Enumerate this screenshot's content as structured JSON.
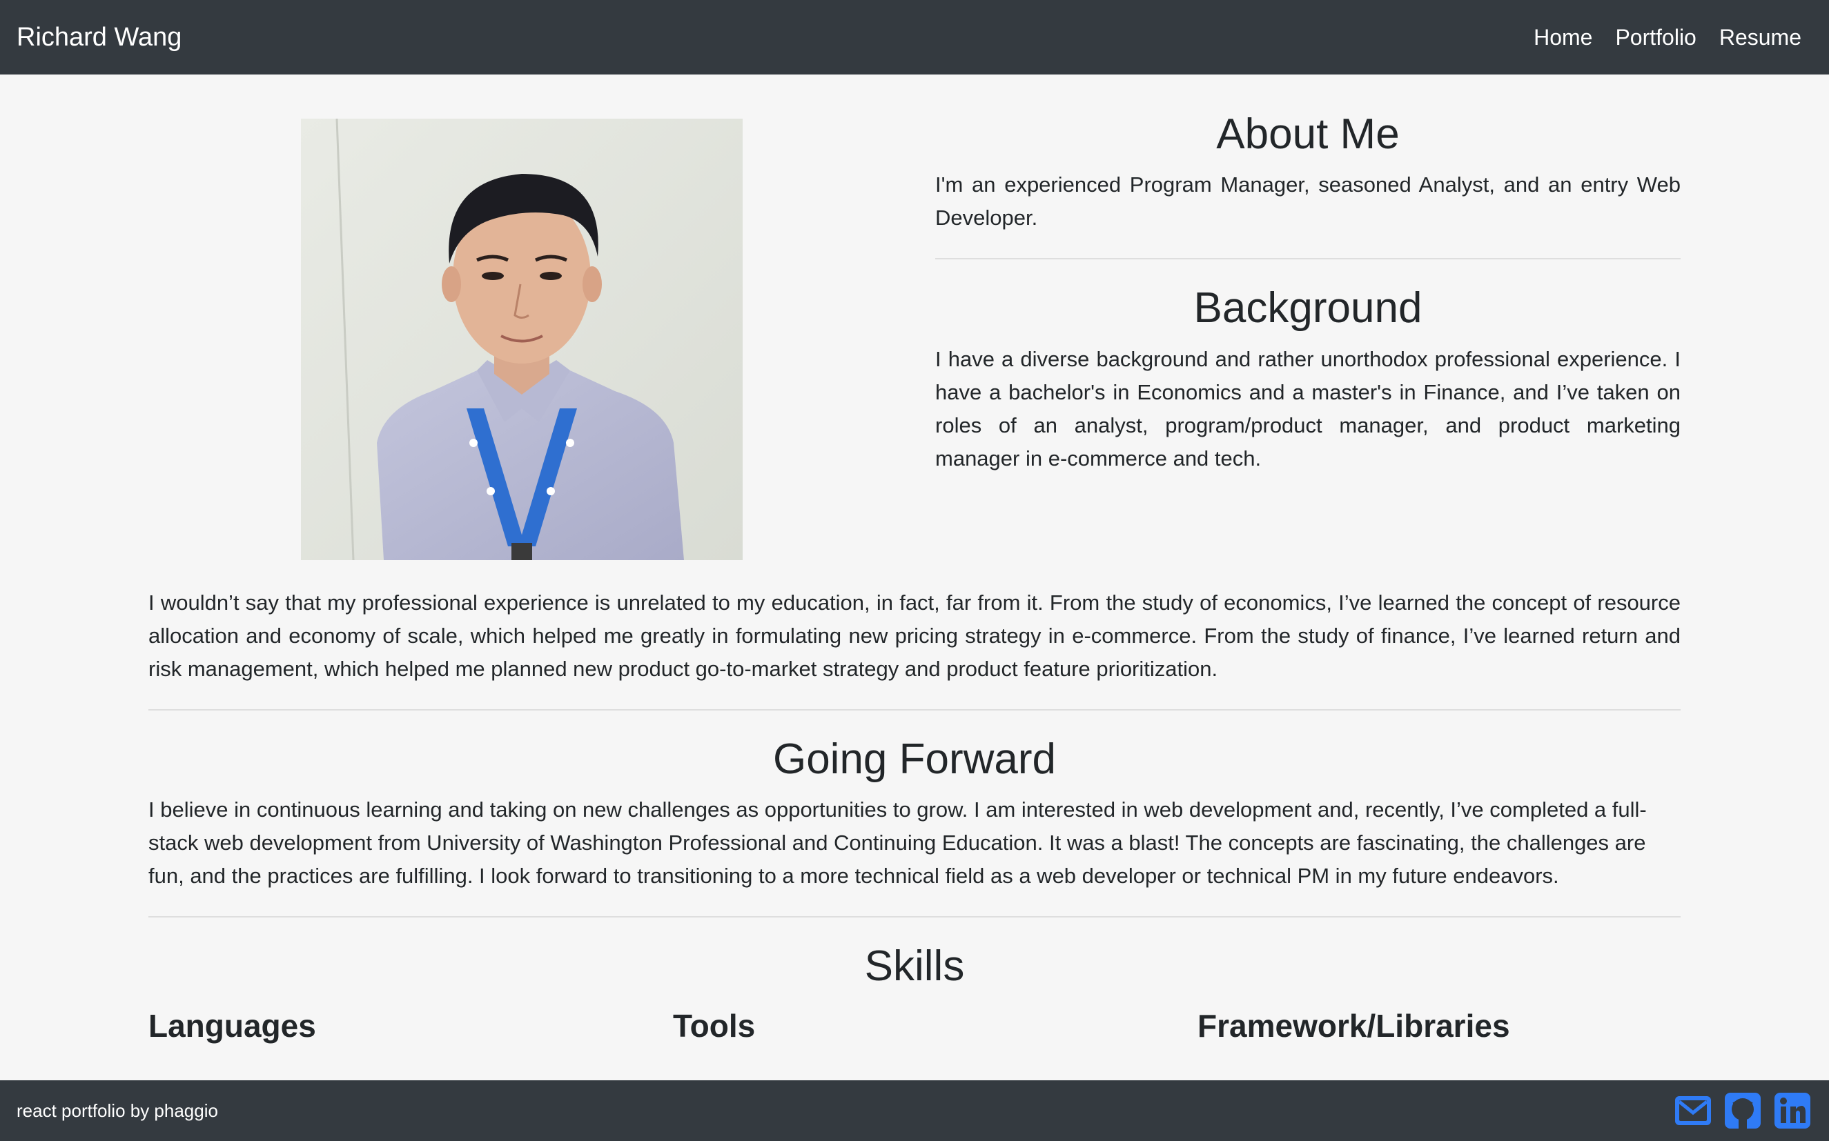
{
  "nav": {
    "brand": "Richard Wang",
    "links": [
      "Home",
      "Portfolio",
      "Resume"
    ]
  },
  "about": {
    "title": "About Me",
    "text": "I'm an experienced Program Manager, seasoned Analyst, and an entry Web Developer."
  },
  "background": {
    "title": "Background",
    "text": "I have a diverse background and rather unorthodox professional experience. I have a bachelor's in Economics and a master's in Finance, and I’ve taken on roles of an analyst, program/product manager, and product marketing manager in e-commerce and tech.",
    "continued": "I wouldn’t say that my professional experience is unrelated to my education, in fact, far from it. From the study of economics, I’ve learned the concept of resource allocation and economy of scale, which helped me greatly in formulating new pricing strategy in e-commerce. From the study of finance, I’ve learned return and risk management, which helped me planned new product go-to-market strategy and product feature prioritization."
  },
  "forward": {
    "title": "Going Forward",
    "text": "I believe in continuous learning and taking on new challenges as opportunities to grow. I am interested in web development and, recently, I’ve completed a full-stack web development from University of Washington Professional and Continuing Education. It was a blast! The concepts are fascinating, the challenges are fun, and the practices are fulfilling. I look forward to transitioning to a more technical field as a web developer or technical PM in my future endeavors."
  },
  "skills": {
    "title": "Skills",
    "columns": [
      "Languages",
      "Tools",
      "Framework/Libraries"
    ]
  },
  "footer": {
    "text": "react portfolio by phaggio",
    "icons": [
      "email-icon",
      "github-icon",
      "linkedin-icon"
    ],
    "icon_color": "#2f7bf6"
  },
  "colors": {
    "navbar": "#343a40",
    "background": "#f6f6f6",
    "text": "#222629"
  }
}
